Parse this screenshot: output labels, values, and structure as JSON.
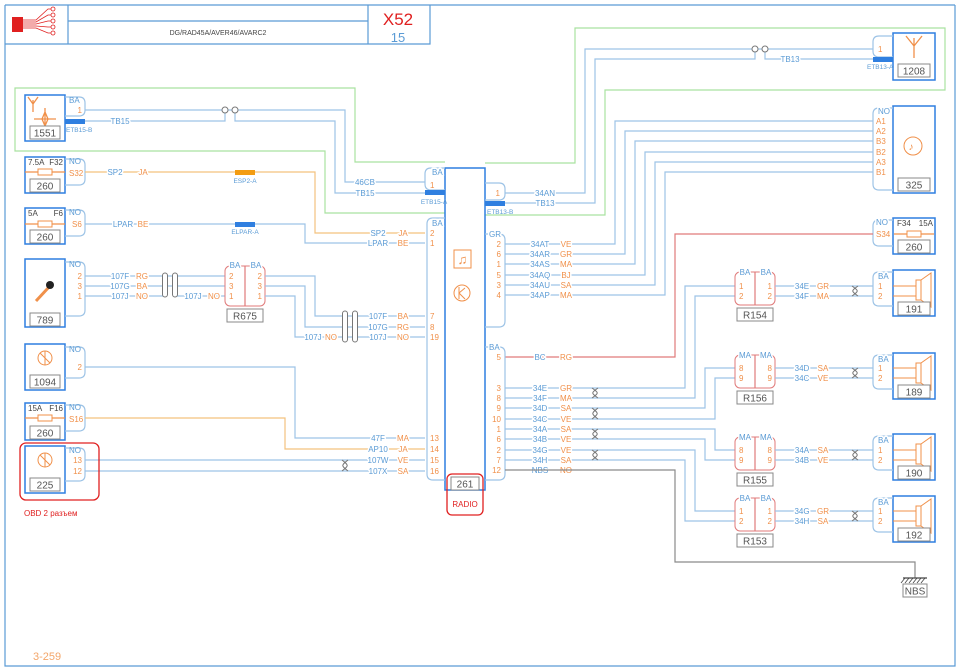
{
  "header": {
    "title": "DG/RAD45A/AVER46/AVARC2",
    "code": "X52",
    "page": "15"
  },
  "footer": {
    "ref": "3-259"
  },
  "notes": {
    "obd": "OBD 2 разъем",
    "radio": "RADIO"
  },
  "colors": {
    "wire": "#9dc3e6",
    "text": "#5b9bd5",
    "pin": "#f0904a",
    "component": "#2f7fe0",
    "shield": "#a9e2a0",
    "supply": "#f3c27e",
    "feed": "#e07a7a",
    "ground": "#8a8a8a",
    "highlight": "#e02020"
  },
  "left": {
    "antenna_1551": {
      "id": "1551",
      "conn": "BA",
      "pin": "1",
      "bar": "ETB15-B",
      "wire": "TB15",
      "icon": "antenna-icon"
    },
    "fuse_f32": {
      "id": "260",
      "rating": "7.5A",
      "fuse": "F32",
      "conn": "NO",
      "pin": "S32",
      "wire": "SP2",
      "color": "JA",
      "bar": "ESP2-A"
    },
    "fuse_f6": {
      "id": "260",
      "rating": "5A",
      "fuse": "F6",
      "conn": "NO",
      "pin": "S6",
      "wire": "LPAR",
      "color": "BE",
      "bar": "ELPAR-A"
    },
    "mic_789": {
      "id": "789",
      "conn": "NO",
      "pins": [
        "2",
        "3",
        "1"
      ],
      "wires": [
        "107F",
        "107G",
        "107J"
      ],
      "colors": [
        "RG",
        "BA",
        "NO"
      ],
      "icon": "microphone-icon"
    },
    "relay_r675": {
      "id": "R675",
      "conn_left": "BA",
      "conn_right": "BA",
      "pins": [
        "2",
        "3",
        "1"
      ],
      "mid_wire": "107J",
      "mid_color": "NO",
      "out_wire": "107J",
      "out_color": "NO"
    },
    "module_1094": {
      "id": "1094",
      "conn": "NO",
      "pin": "2"
    },
    "fuse_f16": {
      "id": "260",
      "rating": "15A",
      "fuse": "F16",
      "conn": "NO",
      "pin": "S16"
    },
    "obd_225": {
      "id": "225",
      "conn": "NO",
      "pins": [
        "13",
        "12"
      ]
    }
  },
  "radio": {
    "id": "261",
    "conn_a": "BA",
    "conn_a_pin": "1",
    "bar_a": "ETB15-A",
    "wire_a1": "46CB",
    "wire_a2": "TB15",
    "conn_b": "BA",
    "left_pins": [
      {
        "pin": "2",
        "wire": "SP2",
        "color": "JA"
      },
      {
        "pin": "1",
        "wire": "LPAR",
        "color": "BE"
      },
      {
        "pin": "7",
        "wire": "107F",
        "color": "BA"
      },
      {
        "pin": "8",
        "wire": "107G",
        "color": "RG"
      },
      {
        "pin": "19",
        "wire": "107J",
        "color": "NO"
      },
      {
        "pin": "13",
        "wire": "47F",
        "color": "MA"
      },
      {
        "pin": "14",
        "wire": "AP10",
        "color": "JA"
      },
      {
        "pin": "15",
        "wire": "107W",
        "color": "VE"
      },
      {
        "pin": "16",
        "wire": "107X",
        "color": "SA"
      }
    ],
    "conn_c_pin": "1",
    "wire_c1": "34AN",
    "wire_c2": "TB13",
    "bar_c": "ETB13-B",
    "conn_gr": "GR",
    "gr_pins": [
      {
        "pin": "2",
        "wire": "34AT",
        "color": "VE"
      },
      {
        "pin": "6",
        "wire": "34AR",
        "color": "GR"
      },
      {
        "pin": "1",
        "wire": "34AS",
        "color": "MA"
      },
      {
        "pin": "5",
        "wire": "34AQ",
        "color": "BJ"
      },
      {
        "pin": "3",
        "wire": "34AU",
        "color": "SA"
      },
      {
        "pin": "4",
        "wire": "34AP",
        "color": "MA"
      }
    ],
    "conn_ba": "BA",
    "ba_pins": [
      {
        "pin": "5",
        "wire": "BC",
        "color": "RG"
      },
      {
        "pin": "3",
        "wire": "34E",
        "color": "GR"
      },
      {
        "pin": "8",
        "wire": "34F",
        "color": "MA"
      },
      {
        "pin": "9",
        "wire": "34D",
        "color": "SA"
      },
      {
        "pin": "10",
        "wire": "34C",
        "color": "VE"
      },
      {
        "pin": "1",
        "wire": "34A",
        "color": "SA"
      },
      {
        "pin": "6",
        "wire": "34B",
        "color": "VE"
      },
      {
        "pin": "2",
        "wire": "34G",
        "color": "VE"
      },
      {
        "pin": "7",
        "wire": "34H",
        "color": "SA"
      },
      {
        "pin": "12",
        "wire": "NBS",
        "color": "NO"
      }
    ]
  },
  "right": {
    "antenna_1208": {
      "id": "1208",
      "pin": "1",
      "bar": "ETB13-A",
      "wire": "TB13"
    },
    "amp_325": {
      "id": "325",
      "conn": "NO",
      "pins": [
        "A1",
        "A2",
        "B3",
        "B2",
        "A3",
        "B1"
      ]
    },
    "fuse_f34": {
      "id": "260",
      "fuse": "F34",
      "rating": "15A",
      "conn": "NO",
      "pin": "S34"
    },
    "relays": [
      {
        "id": "R154",
        "conn_left": "BA",
        "conn_right": "BA",
        "pins": [
          "1",
          "2"
        ],
        "wires": [
          "34E",
          "34F"
        ],
        "colors": [
          "GR",
          "MA"
        ]
      },
      {
        "id": "R156",
        "conn_left": "MA",
        "conn_right": "MA",
        "pins": [
          "8",
          "9"
        ],
        "wires": [
          "34D",
          "34C"
        ],
        "colors": [
          "SA",
          "VE"
        ]
      },
      {
        "id": "R155",
        "conn_left": "MA",
        "conn_right": "MA",
        "pins": [
          "8",
          "9"
        ],
        "wires": [
          "34A",
          "34B"
        ],
        "colors": [
          "SA",
          "VE"
        ]
      },
      {
        "id": "R153",
        "conn_left": "BA",
        "conn_right": "BA",
        "pins": [
          "1",
          "2"
        ],
        "wires": [
          "34G",
          "34H"
        ],
        "colors": [
          "GR",
          "SA"
        ]
      }
    ],
    "speakers": [
      {
        "id": "191",
        "conn": "BA",
        "pins": [
          "1",
          "2"
        ]
      },
      {
        "id": "189",
        "conn": "BA",
        "pins": [
          "1",
          "2"
        ]
      },
      {
        "id": "190",
        "conn": "BA",
        "pins": [
          "1",
          "2"
        ]
      },
      {
        "id": "192",
        "conn": "BA",
        "pins": [
          "1",
          "2"
        ]
      }
    ],
    "ground": {
      "id": "NBS"
    }
  }
}
